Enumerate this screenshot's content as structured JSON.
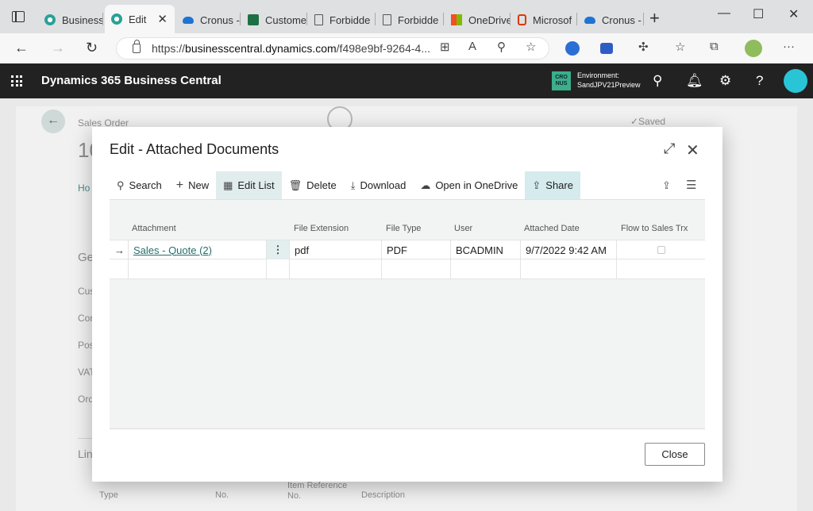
{
  "browser": {
    "tabs": [
      {
        "label": "Business",
        "icon": "bc-gear-icon",
        "active": false
      },
      {
        "label": "Edit",
        "icon": "bc-gear-icon",
        "active": true
      },
      {
        "label": "Cronus -",
        "icon": "onedrive-cloud-icon",
        "active": false
      },
      {
        "label": "Custome",
        "icon": "excel-icon",
        "active": false
      },
      {
        "label": "Forbidde",
        "icon": "page-icon",
        "active": false
      },
      {
        "label": "Forbidde",
        "icon": "page-icon",
        "active": false
      },
      {
        "label": "OneDrive",
        "icon": "microsoft-logo-icon",
        "active": false
      },
      {
        "label": "Microsof",
        "icon": "office-icon",
        "active": false
      },
      {
        "label": "Cronus -",
        "icon": "onedrive-cloud-icon",
        "active": false
      }
    ],
    "close_glyph": "✕",
    "url_prefix": "https://",
    "url_host": "businesscentral.dynamics.com",
    "url_rest": "/f498e9bf-9264-4..."
  },
  "app": {
    "title": "Dynamics 365 Business Central",
    "company_badge": "CRO NUS",
    "env_label": "Environment:",
    "env_name": "SandJPV21Preview"
  },
  "background_page": {
    "caption": "Sales Order",
    "number_partial": "10",
    "tab_partial": "Ho",
    "section_partial": "Ge",
    "fields": [
      "Cus",
      "Con",
      "Pos",
      "VAT",
      "Ord"
    ],
    "lines_partial": "Lin",
    "saved": "✓Saved",
    "line_headers": [
      "Type",
      "No.",
      "Item Reference No.",
      "Description"
    ]
  },
  "dialog": {
    "title": "Edit - Attached Documents",
    "actions": [
      {
        "label": "Search",
        "icon": "search-icon",
        "glyph": "⚲"
      },
      {
        "label": "New",
        "icon": "plus-icon",
        "glyph": "+"
      },
      {
        "label": "Edit List",
        "icon": "edit-list-icon",
        "glyph": "▦"
      },
      {
        "label": "Delete",
        "icon": "trash-icon",
        "glyph": "🗑"
      },
      {
        "label": "Download",
        "icon": "download-icon",
        "glyph": "⤓"
      },
      {
        "label": "Open in OneDrive",
        "icon": "cloud-icon",
        "glyph": "☁"
      },
      {
        "label": "Share",
        "icon": "share-icon",
        "glyph": "⇪"
      }
    ],
    "columns": [
      "Attachment",
      "File Extension",
      "File Type",
      "User",
      "Attached Date",
      "Flow to Sales Trx"
    ],
    "rows": [
      {
        "attachment": "Sales - Quote (2)",
        "extension": "pdf",
        "type": "PDF",
        "user": "BCADMIN",
        "date": "9/7/2022 9:42 AM",
        "flow": false
      }
    ],
    "close_label": "Close"
  }
}
